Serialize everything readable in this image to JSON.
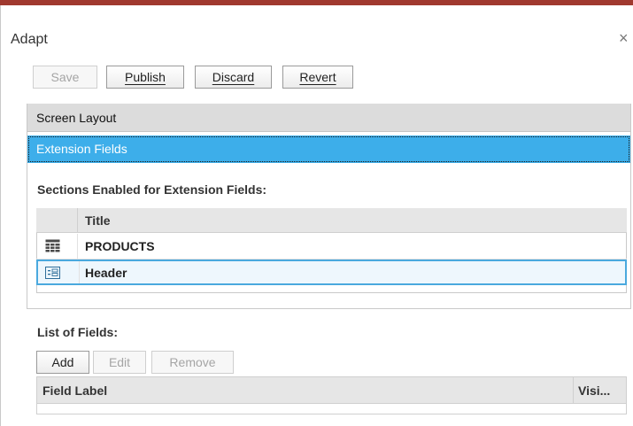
{
  "dialog": {
    "title": "Adapt",
    "close_glyph": "×"
  },
  "toolbar": {
    "save_label": "Save",
    "publish_label": "Publish",
    "discard_label": "Discard",
    "revert_label": "Revert"
  },
  "nav": {
    "items": [
      {
        "label": "Screen Layout",
        "selected": false
      },
      {
        "label": "Extension Fields",
        "selected": true
      }
    ]
  },
  "sections": {
    "heading": "Sections Enabled for Extension Fields:",
    "columns": [
      "Title"
    ],
    "rows": [
      {
        "icon": "table-grid-icon",
        "title": "PRODUCTS"
      },
      {
        "icon": "form-header-icon",
        "title": "Header",
        "selected": true
      }
    ]
  },
  "fields": {
    "heading": "List of Fields:",
    "add_label": "Add",
    "edit_label": "Edit",
    "remove_label": "Remove",
    "columns": [
      "Field Label",
      "Visi..."
    ]
  },
  "colors": {
    "accent": "#3daeea",
    "top_bar": "#a0392f"
  }
}
